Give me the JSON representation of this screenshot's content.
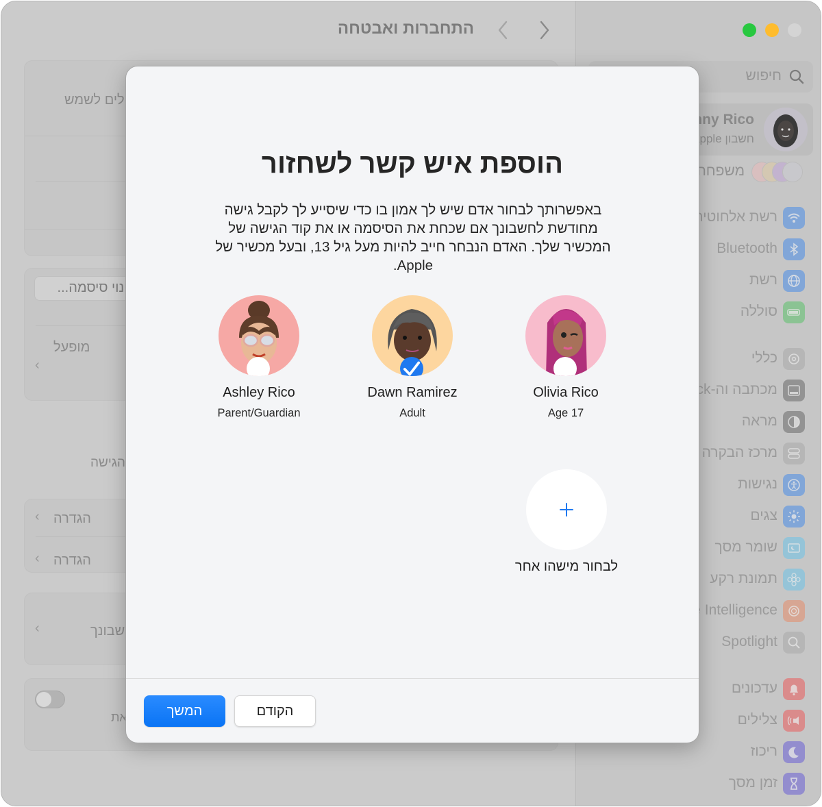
{
  "window": {
    "traffic_lights": [
      {
        "name": "zoom",
        "color": "#28c840"
      },
      {
        "name": "minimize",
        "color": "#febc2e"
      },
      {
        "name": "close",
        "color": "#d4d4d4"
      }
    ]
  },
  "toolbar": {
    "title": "התחברות ואבטחה",
    "back_icon": "chevron-left-icon",
    "forward_icon": "chevron-right-icon"
  },
  "background_content": {
    "row1_label": "ולים לשמש",
    "change_password_button": "שינוי סיסמה...",
    "status_value": "מופעל",
    "recovery_label": "הגישה",
    "setup_row1": "הגדרה",
    "setup_row2": "הגדרה",
    "account_row": "חשבונך",
    "toggle_row_label": "את",
    "toggle_state": "off"
  },
  "sidebar": {
    "search_placeholder": "חיפוש",
    "account": {
      "name": "Danny Rico",
      "subtitle": "חשבון Apple"
    },
    "family_label": "משפחה",
    "items": [
      {
        "label": "רשת אלחוטית",
        "icon": "wifi-icon",
        "color": "#4a8de8"
      },
      {
        "label": "Bluetooth",
        "icon": "bluetooth-icon",
        "color": "#4a8de8"
      },
      {
        "label": "רשת",
        "icon": "globe-icon",
        "color": "#4a8de8"
      },
      {
        "label": "סוללה",
        "icon": "battery-icon",
        "color": "#5cc16a"
      },
      {
        "label": "כללי",
        "icon": "gear-icon",
        "color": "#a9a9a9"
      },
      {
        "label": "מכתבה וה-Dock",
        "icon": "dock-icon",
        "color": "#6b6b6b"
      },
      {
        "label": "מראה",
        "icon": "appearance-icon",
        "color": "#6b6b6b"
      },
      {
        "label": "מרכז הבקרה",
        "icon": "control-center-icon",
        "color": "#a9a9a9"
      },
      {
        "label": "נגישות",
        "icon": "accessibility-icon",
        "color": "#4a8de8"
      },
      {
        "label": "צגים",
        "icon": "display-icon",
        "color": "#4a8de8"
      },
      {
        "label": "שומר מסך",
        "icon": "screensaver-icon",
        "color": "#6ec4e8"
      },
      {
        "label": "תמונת רקע",
        "icon": "wallpaper-icon",
        "color": "#6ec4e8"
      },
      {
        "label": "Apple Intelligence",
        "icon": "intelligence-icon",
        "color": "#e58c6a"
      },
      {
        "label": "Spotlight",
        "icon": "spotlight-icon",
        "color": "#a9a9a9"
      },
      {
        "label": "עדכונים",
        "icon": "notifications-icon",
        "color": "#ec5b5b"
      },
      {
        "label": "צלילים",
        "icon": "sound-icon",
        "color": "#ec5b5b"
      },
      {
        "label": "ריכוז",
        "icon": "focus-icon",
        "color": "#6a5fd6"
      },
      {
        "label": "זמן מסך",
        "icon": "screen-time-icon",
        "color": "#6a5fd6"
      }
    ]
  },
  "modal": {
    "title": "הוספת איש קשר לשחזור",
    "description": "באפשרותך לבחור אדם שיש לך אמון בו כדי שיסייע לך לקבל גישה מחודשת לחשבונך אם שכחת את הסיסמה או את קוד הגישה של המכשיר שלך. האדם הנבחר חייב להיות מעל גיל 13, ובעל מכשיר של Apple.",
    "people": [
      {
        "name": "Olivia Rico",
        "role": "Age 17",
        "selected": false,
        "avatar_bg": "#f7b7c9"
      },
      {
        "name": "Dawn Ramirez",
        "role": "Adult",
        "selected": true,
        "avatar_bg": "#fcd49a"
      },
      {
        "name": "Ashley Rico",
        "role": "Parent/Guardian",
        "selected": false,
        "avatar_bg": "#f6a6a3"
      }
    ],
    "choose_other_label": "לבחור מישהו אחר",
    "buttons": {
      "continue": "המשך",
      "back": "הקודם"
    },
    "accent_color": "#1f79f0"
  }
}
